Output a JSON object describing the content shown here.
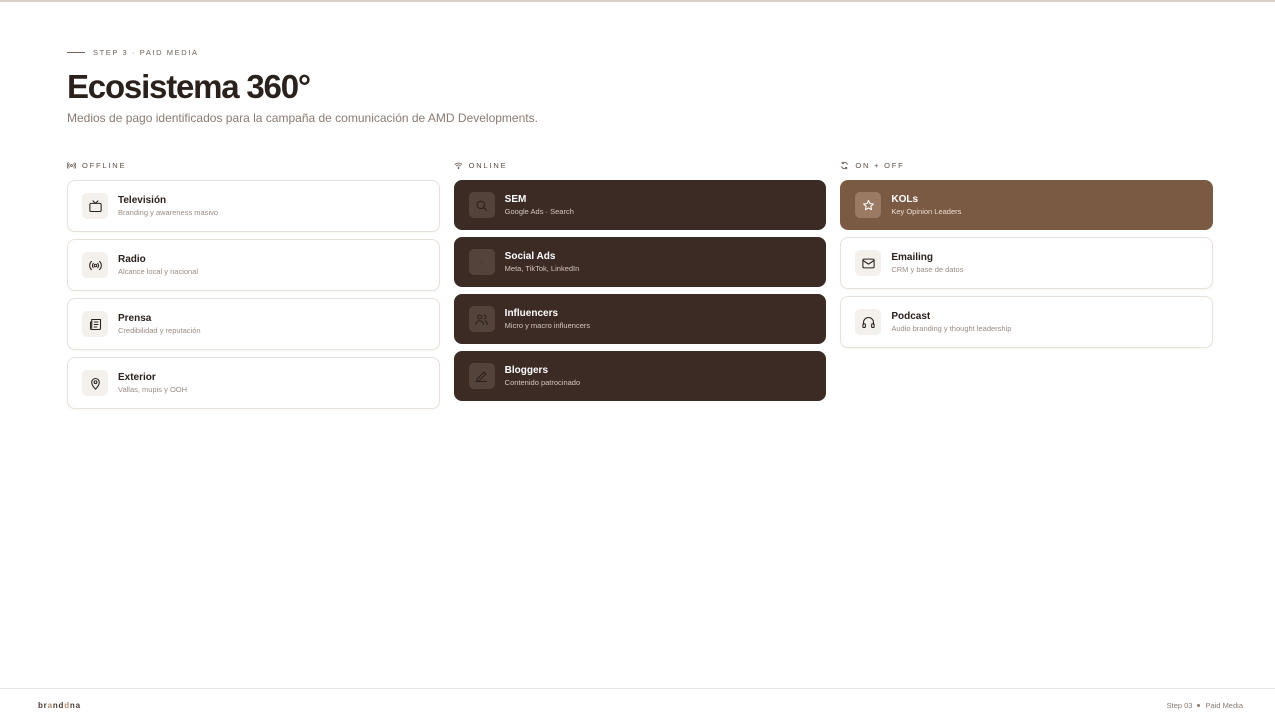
{
  "header": {
    "eyebrow": "STEP 3 · PAID MEDIA",
    "title": "Ecosistema 360°",
    "subtitle": "Medios de pago identificados para la campaña de comunicación de AMD Developments."
  },
  "columns": [
    {
      "heading": "OFFLINE",
      "icon": "broadcast-icon",
      "items": [
        {
          "title": "Televisión",
          "subtitle": "Branding y awareness masivo",
          "icon": "tv-icon"
        },
        {
          "title": "Radio",
          "subtitle": "Alcance local y nacional",
          "icon": "radio-icon"
        },
        {
          "title": "Prensa",
          "subtitle": "Credibilidad y reputación",
          "icon": "newspaper-icon"
        },
        {
          "title": "Exterior",
          "subtitle": "Vallas, mupis y OOH",
          "icon": "map-pin-icon"
        }
      ]
    },
    {
      "heading": "ONLINE",
      "icon": "wifi-icon",
      "items": [
        {
          "title": "SEM",
          "subtitle": "Google Ads · Search",
          "icon": "search-icon"
        },
        {
          "title": "Social Ads",
          "subtitle": "Meta, TikTok, LinkedIn",
          "icon": "social-icon"
        },
        {
          "title": "Influencers",
          "subtitle": "Micro y macro influencers",
          "icon": "users-icon"
        },
        {
          "title": "Bloggers",
          "subtitle": "Contenido patrocinado",
          "icon": "pen-icon"
        }
      ]
    },
    {
      "heading": "ON + OFF",
      "icon": "refresh-icon",
      "items": [
        {
          "title": "KOLs",
          "subtitle": "Key Opinion Leaders",
          "icon": "star-icon"
        },
        {
          "title": "Emailing",
          "subtitle": "CRM y base de datos",
          "icon": "mail-icon"
        },
        {
          "title": "Podcast",
          "subtitle": "Audio branding y thought leadership",
          "icon": "headphones-icon"
        }
      ]
    }
  ],
  "footer": {
    "logo_a": "br",
    "logo_b": "a",
    "logo_c": "nd",
    "logo_d": "d",
    "logo_e": "na",
    "step": "Step 03",
    "section": "Paid Media"
  },
  "colors": {
    "dark_card": "#3b2b24",
    "accent_card": "#7b5a43",
    "text_primary": "#2b211c"
  }
}
